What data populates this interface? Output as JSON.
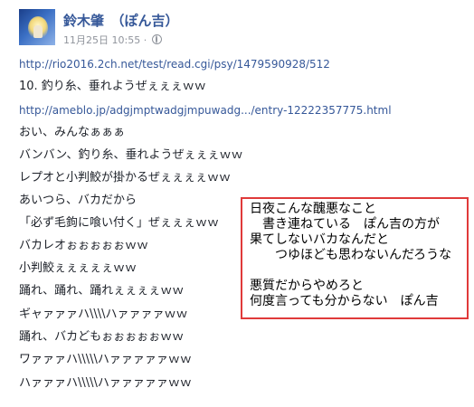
{
  "post": {
    "author": "鈴木肇　（ぽん吉）",
    "date": "11月25日 10:55",
    "separator": "·",
    "privacy_icon": "globe-icon",
    "avatar_icon": "avatar-image",
    "link_color": "#365899"
  },
  "lines": [
    "http://rio2016.2ch.net/test/read.cgi/psy/1479590928/512",
    "10. 釣り糸、垂れようぜぇぇぇｗｗ",
    "http://ameblo.jp/adgjmptwadgjmpuwadg.../entry-12222357775.html",
    "おい、みんなぁぁぁ",
    "バンバン、釣り糸、垂れようぜぇぇぇｗｗ",
    "レプオと小判鮫が掛かるぜぇぇぇぇｗｗ",
    "あいつら、バカだから",
    "「必ず毛鉤に喰い付く」ぜぇぇぇｗｗ",
    "バカレオぉぉぉぉぉｗｗ",
    "小判鮫ぇぇぇぇぇｗｗ",
    "踊れ、踊れ、踊れぇぇぇぇｗｗ",
    "ギャァァァハ\\\\\\\\ハァァァァｗｗ",
    "踊れ、バカどもぉぉぉぉぉｗｗ",
    "ワァァァハ\\\\\\\\\\ハァァァァァｗｗ",
    "ハァァァハ\\\\\\\\\\ハァァァァァｗｗ"
  ],
  "annotation": {
    "border_color": "#e03a3a",
    "lines": [
      "日夜こんな醜悪なこと",
      "　書き連ねている　ぽん吉の方が",
      "果てしないバカなんだと",
      "　　つゆほども思わないんだろうな",
      "",
      "悪質だからやめろと",
      "何度言っても分からない　ぽん吉"
    ]
  }
}
